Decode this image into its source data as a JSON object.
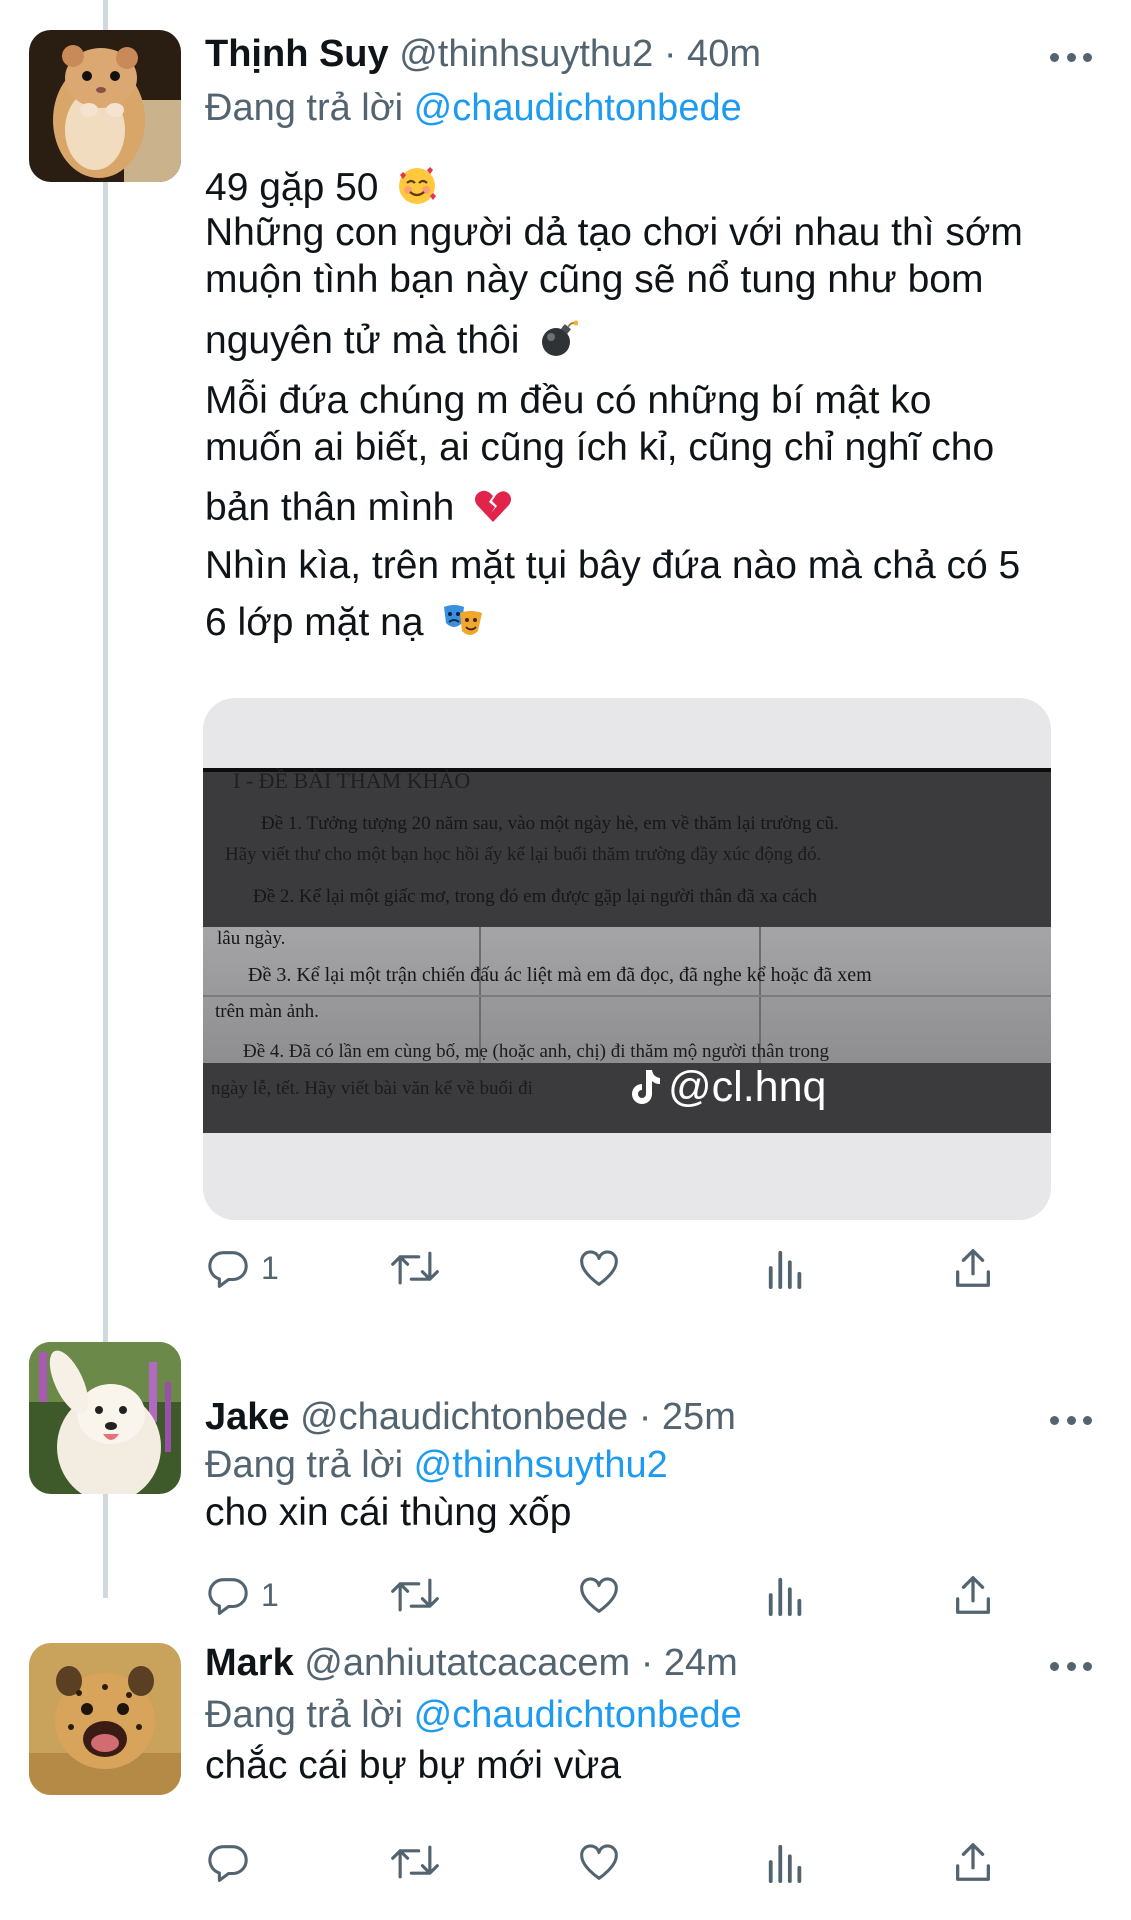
{
  "tweets": [
    {
      "name": "Thịnh Suy",
      "handle": "@thinhsuythu2",
      "time": "40m",
      "meta": "@thinhsuythu2 · 40m",
      "replying_prefix": "Đang trả lời",
      "replying_to": "@chaudichtonbede",
      "lines": [
        "49 gặp 50",
        "Những con người dả tạo chơi với nhau thì sớm",
        "muộn tình bạn này cũng sẽ nổ tung như bom",
        "nguyên tử mà thôi",
        "Mỗi đứa chúng m đều có những bí mật ko",
        "muốn ai biết, ai cũng ích kỉ, cũng chỉ nghĩ cho",
        "bản thân mình",
        "Nhìn kìa, trên mặt tụi bây đứa nào mà chả có 5",
        "6 lớp mặt nạ"
      ],
      "emojis": [
        "smiling-face-with-hearts",
        "bomb",
        "broken-heart",
        "performing-arts"
      ],
      "media": {
        "document_lines": [
          "I - ĐỀ BÀI THAM KHẢO",
          "Đề 1. Tưởng tượng 20 năm sau, vào một ngày hè, em về thăm lại trường cũ.",
          "Hãy viết thư cho một bạn học hồi ấy kể lại buổi thăm trường đầy xúc động đó.",
          "Đề 2. Kể lại một giấc mơ, trong đó em được gặp lại người thân đã xa cách",
          "lâu ngày.",
          "Đề 3. Kể lại một trận chiến đấu ác liệt mà em đã đọc, đã nghe kể hoặc đã xem",
          "trên màn ảnh.",
          "Đề 4. Đã có lần em cùng bố, mẹ (hoặc anh, chị) đi thăm mộ người thân trong",
          "ngày lễ, tết. Hãy viết bài văn kể về buổi đi"
        ],
        "watermark": "@cl.hnq"
      },
      "reply_count": "1",
      "retweet_count": "",
      "like_count": ""
    },
    {
      "name": "Jake",
      "handle": "@chaudichtonbede",
      "time": "25m",
      "meta": "@chaudichtonbede · 25m",
      "replying_prefix": "Đang trả lời",
      "replying_to": "@thinhsuythu2",
      "lines": [
        "cho xin cái thùng xốp"
      ],
      "reply_count": "1"
    },
    {
      "name": "Mark",
      "handle": "@anhiutatcacacem",
      "time": "24m",
      "meta": "@anhiutatcacacem · 24m",
      "replying_prefix": "Đang trả lời",
      "replying_to": "@chaudichtonbede",
      "lines": [
        "chắc cái bự bự mới vừa"
      ],
      "reply_count": ""
    }
  ],
  "colors": {
    "text": "#0f1419",
    "secondary": "#536471",
    "link": "#1d9bf0",
    "thread_line": "#cfd9de"
  },
  "icons": [
    "reply-icon",
    "retweet-icon",
    "like-icon",
    "analytics-icon",
    "share-icon",
    "more-icon"
  ]
}
